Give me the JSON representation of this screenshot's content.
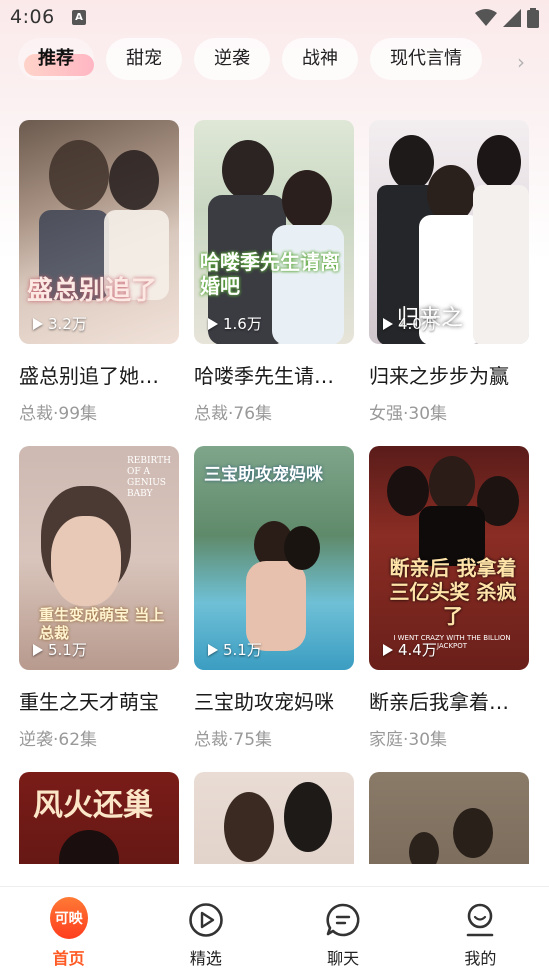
{
  "status_bar": {
    "time": "4:06",
    "notification_letter": "A"
  },
  "tabs": [
    {
      "label": "推荐",
      "active": true
    },
    {
      "label": "甜宠",
      "active": false
    },
    {
      "label": "逆袭",
      "active": false
    },
    {
      "label": "战神",
      "active": false
    },
    {
      "label": "现代言情",
      "active": false
    }
  ],
  "cards": [
    {
      "title": "盛总别追了她…",
      "meta": "总裁·99集",
      "views": "3.2万",
      "poster_text": "盛总别追了"
    },
    {
      "title": "哈喽季先生请…",
      "meta": "总裁·76集",
      "views": "1.6万",
      "poster_text": "哈喽季先生请离婚吧"
    },
    {
      "title": "归来之步步为赢",
      "meta": "女强·30集",
      "views": "4.0万",
      "poster_text": "归来之"
    },
    {
      "title": "重生之天才萌宝",
      "meta": "逆袭·62集",
      "views": "5.1万",
      "poster_text": "重生变成萌宝 当上总裁",
      "poster_subtext": "REBIRTH OF A GENIUS BABY"
    },
    {
      "title": "三宝助攻宠妈咪",
      "meta": "总裁·75集",
      "views": "5.1万",
      "poster_text": "三宝助攻宠妈咪"
    },
    {
      "title": "断亲后我拿着…",
      "meta": "家庭·30集",
      "views": "4.4万",
      "poster_text": "断亲后 我拿着 三亿头奖 杀疯了",
      "poster_subtext": "I WENT CRAZY WITH THE BILLION JACKPOT"
    },
    {
      "poster_text": "风火还巢"
    },
    {},
    {}
  ],
  "nav": {
    "brand": "可映",
    "items": [
      {
        "label": "首页",
        "active": true
      },
      {
        "label": "精选",
        "active": false
      },
      {
        "label": "聊天",
        "active": false
      },
      {
        "label": "我的",
        "active": false
      }
    ]
  },
  "colors": {
    "accent": "#ff5a23",
    "meta_text": "#999999"
  }
}
